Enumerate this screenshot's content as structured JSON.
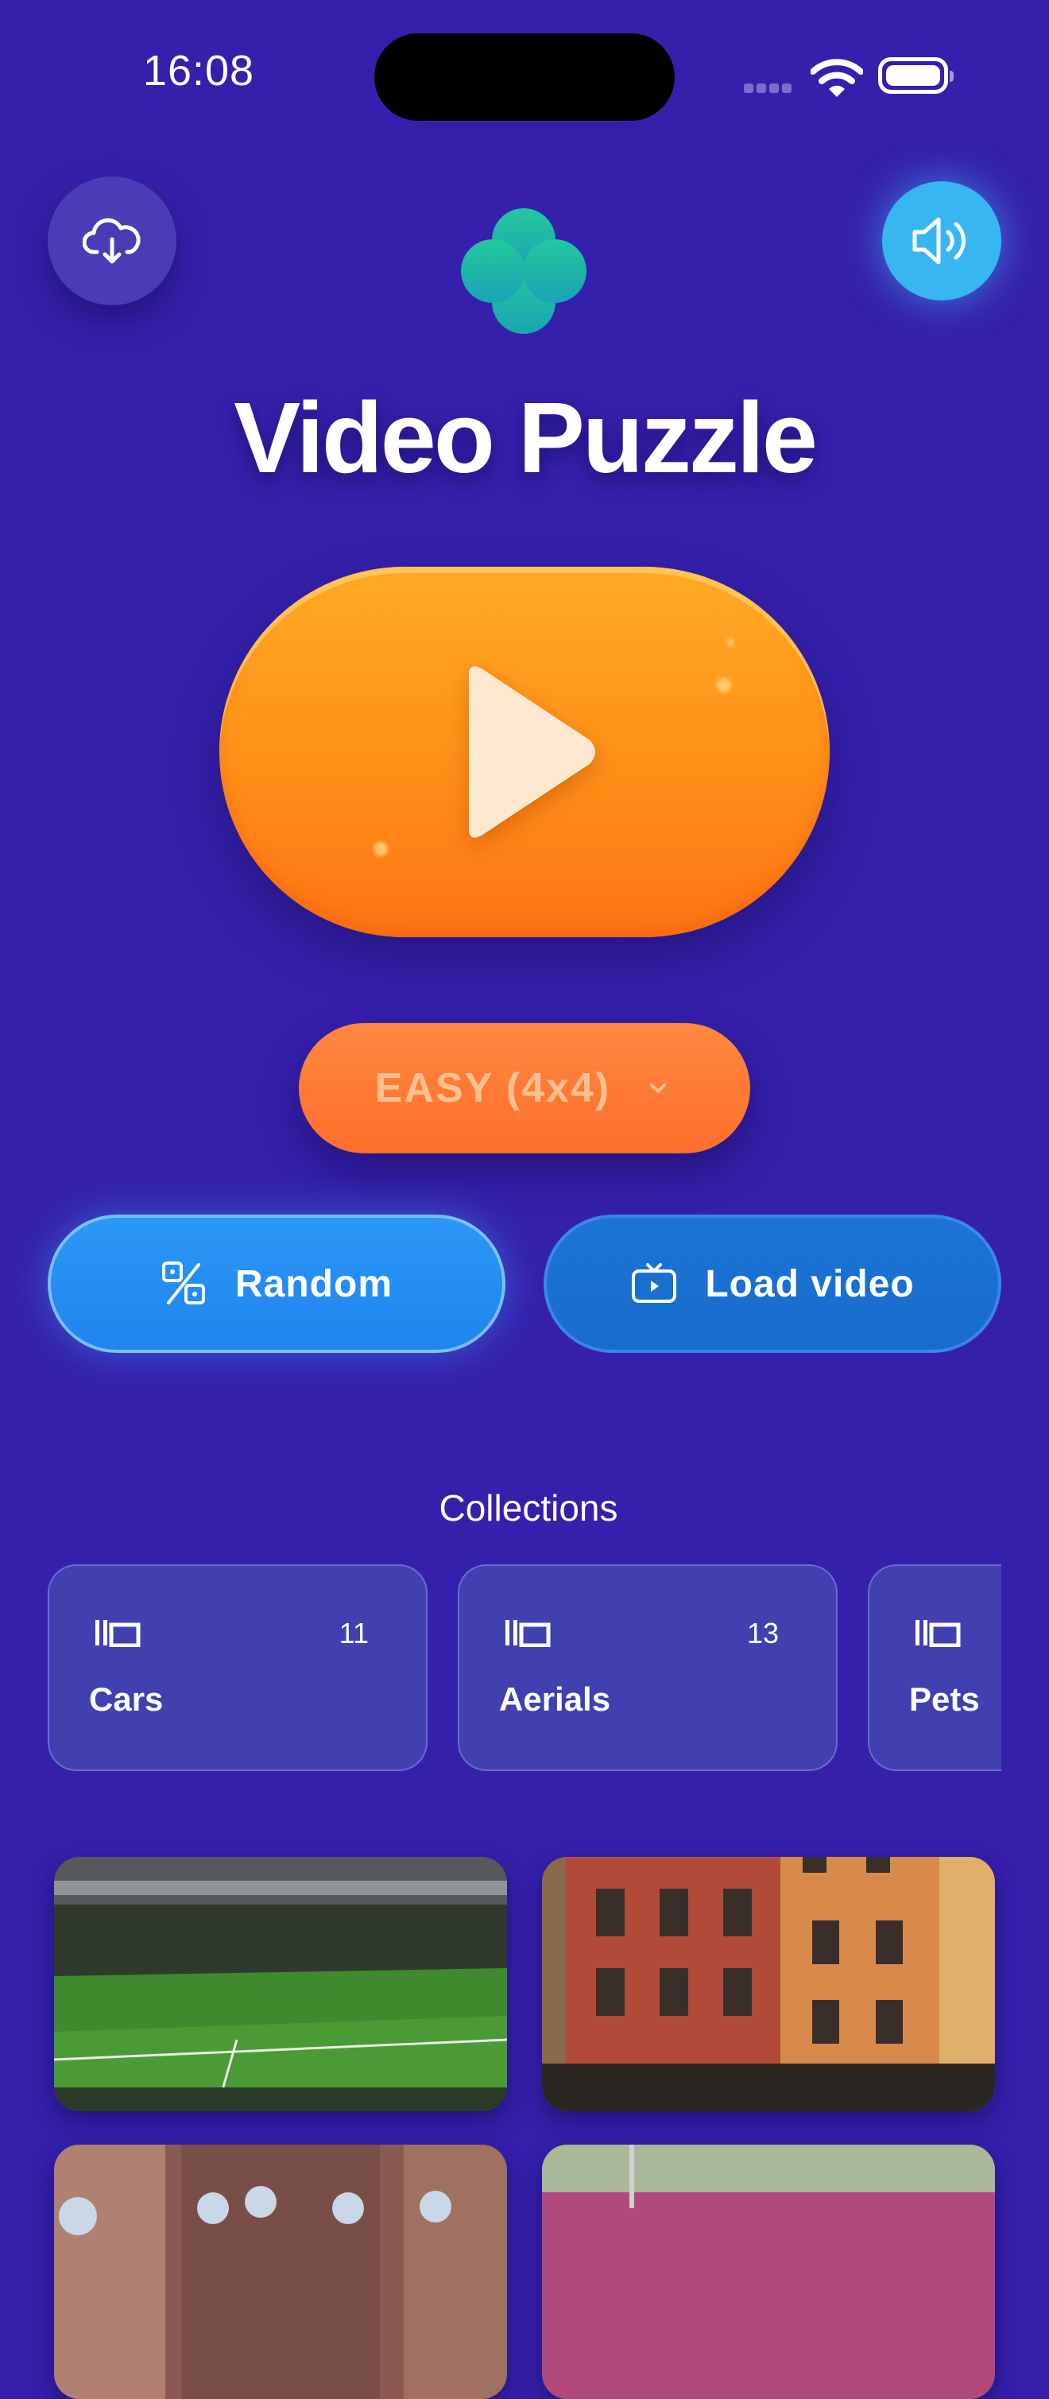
{
  "status_bar": {
    "time": "16:08"
  },
  "header": {
    "cloud_icon": "cloud-download-icon",
    "sound_icon": "speaker-icon",
    "logo_icon": "clover-logo-icon",
    "app_title": "Video Puzzle"
  },
  "play": {
    "icon": "play-icon"
  },
  "difficulty": {
    "label": "EASY (4x4)",
    "icon": "chevron-down-icon"
  },
  "actions": {
    "random": {
      "label": "Random",
      "icon": "dice-icon"
    },
    "load": {
      "label": "Load video",
      "icon": "tv-icon"
    }
  },
  "collections": {
    "title": "Collections",
    "items": [
      {
        "name": "Cars",
        "count": "11"
      },
      {
        "name": "Aerials",
        "count": "13"
      },
      {
        "name": "Pets"
      }
    ]
  },
  "videos": [
    {
      "scene": "stadium"
    },
    {
      "scene": "old-town-buildings"
    },
    {
      "scene": "ceremony"
    },
    {
      "scene": "crowd"
    }
  ],
  "colors": {
    "background": "#3520ac",
    "play": "#ff8f18",
    "difficulty": "#ff7a36",
    "random": "#2b97f6",
    "load": "#1a74d6",
    "sound": "#37b6f2",
    "logo": "#20c4a8"
  }
}
